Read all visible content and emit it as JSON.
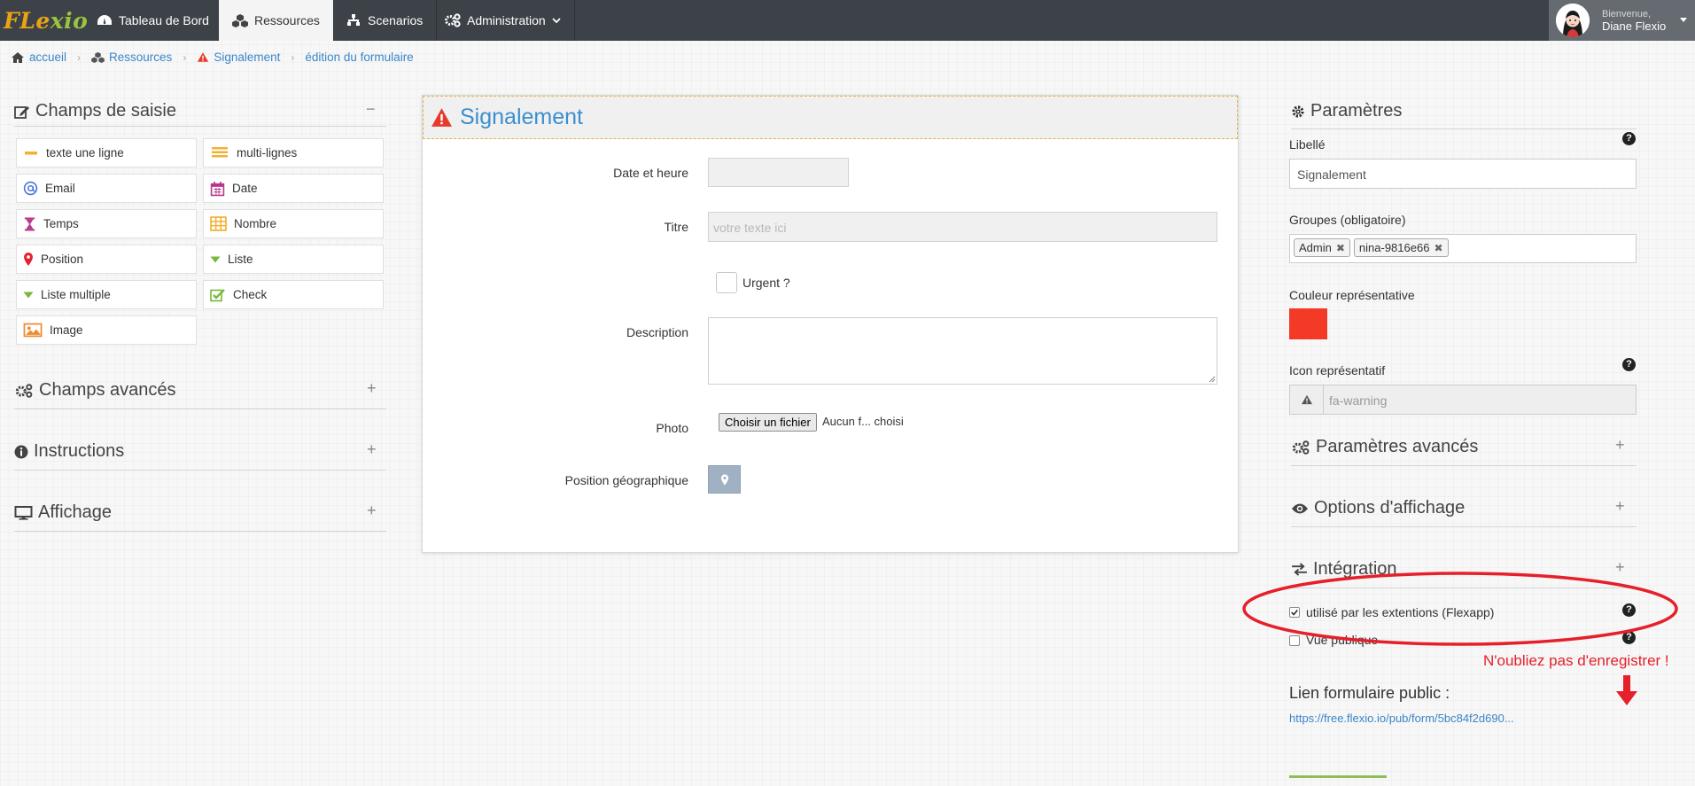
{
  "app": {
    "brand_part1": "FLe",
    "brand_part2": "xio"
  },
  "nav": {
    "dashboard": "Tableau de Bord",
    "resources": "Ressources",
    "scenarios": "Scenarios",
    "administration": "Administration"
  },
  "user": {
    "welcome": "Bienvenue,",
    "name": "Diane Flexio"
  },
  "breadcrumb": {
    "home": "accueil",
    "resources": "Ressources",
    "current": "Signalement",
    "page": "édition du formulaire"
  },
  "left": {
    "input_fields_title": "Champs de saisie",
    "input_fields_toggle": "−",
    "fields": {
      "single_line": "texte une ligne",
      "multi_line": "multi-lignes",
      "email": "Email",
      "date": "Date",
      "time": "Temps",
      "number": "Nombre",
      "position": "Position",
      "list": "Liste",
      "multi_list": "Liste multiple",
      "check": "Check",
      "image": "Image"
    },
    "advanced_title": "Champs avancés",
    "instructions_title": "Instructions",
    "display_title": "Affichage",
    "expand_toggle": "+"
  },
  "form": {
    "title": "Signalement",
    "date_label": "Date et heure",
    "title_label": "Titre",
    "title_placeholder": "votre texte ici",
    "urgent_label": "Urgent ?",
    "description_label": "Description",
    "photo_label": "Photo",
    "file_button": "Choisir un fichier",
    "file_status": "Aucun f... choisi",
    "geo_label": "Position géographique"
  },
  "right": {
    "params_title": "Paramètres",
    "label_label": "Libellé",
    "label_value": "Signalement",
    "groups_label": "Groupes (obligatoire)",
    "groups": [
      "Admin",
      "nina-9816e66"
    ],
    "color_label": "Couleur représentative",
    "color_value": "#f33a26",
    "icon_label": "Icon représentatif",
    "icon_value": "fa-warning",
    "advanced_params_title": "Paramètres avancés",
    "display_options_title": "Options d'affichage",
    "integration_title": "Intégration",
    "used_by_extensions": "utilisé par les extentions (Flexapp)",
    "used_by_extensions_checked": true,
    "public_view": "Vue publique",
    "public_view_checked": false,
    "reminder": "N'oubliez pas d'enregistrer !",
    "public_link_title": "Lien formulaire public :",
    "public_link": "https://free.flexio.io/pub/form/5bc84f2d690..."
  },
  "colors": {
    "navbar": "#3c4247",
    "link": "#3a85c9",
    "annotation_red": "#e5202b",
    "brand_orange": "#e8a317",
    "brand_green": "#9bc33e"
  }
}
